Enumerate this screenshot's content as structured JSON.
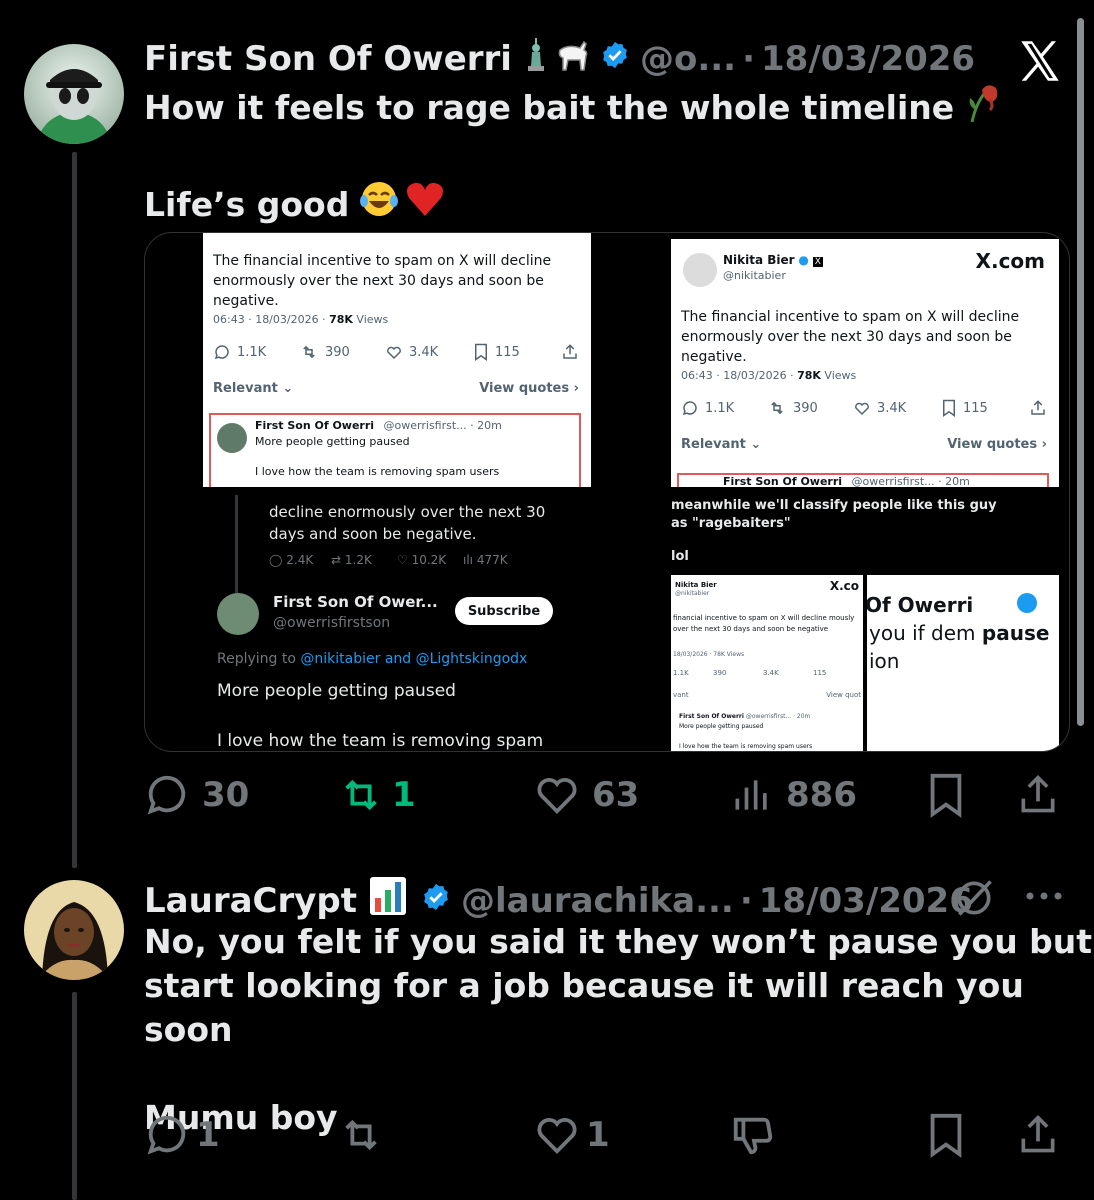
{
  "tweet1": {
    "display_name": "First Son Of Owerri",
    "handle": "@o...",
    "separator": "·",
    "date": "18/03/2026",
    "line1": "How it feels to rage bait the whole timeline",
    "line2": "Life’s good",
    "replies": "30",
    "reposts": "1",
    "likes": "63",
    "views": "886"
  },
  "media": {
    "a": {
      "text": "The financial incentive to spam on X will decline enormously over the next 30 days and soon be negative.",
      "meta_time": "06:43 · 18/03/2026 · ",
      "meta_views": "78K",
      "meta_views_label": " Views",
      "replies": "1.1K",
      "reposts": "390",
      "likes": "3.4K",
      "bookmarks": "115",
      "relevant": "Relevant",
      "view_quotes": "View quotes",
      "reply_name": "First Son Of Owerri",
      "reply_handle": "@owerrisfirst... · 20m",
      "reply_text1": "More people getting paused",
      "reply_text2": "I love how the team is removing spam users"
    },
    "b": {
      "name": "Nikita Bier",
      "handle": "@nikitabier",
      "brand": "X.com",
      "text": "The financial incentive to spam on X will decline enormously over the next 30 days and soon be negative.",
      "meta_time": "06:43 · 18/03/2026 · ",
      "meta_views": "78K",
      "meta_views_label": " Views",
      "replies": "1.1K",
      "reposts": "390",
      "likes": "3.4K",
      "bookmarks": "115",
      "relevant": "Relevant",
      "view_quotes": "View quotes",
      "reply_name": "First Son Of Owerri",
      "reply_handle": "@owerrisfirst... · 20m"
    },
    "c": {
      "text": "decline enormously over the next 30 days and soon be negative.",
      "replies": "2.4K",
      "reposts": "1.2K",
      "likes": "10.2K",
      "views": "477K",
      "name": "First Son Of Ower...",
      "handle": "@owerrisfirstson",
      "subscribe": "Subscribe",
      "replying_prefix": "Replying to ",
      "replying_targets": "@nikitabier and @Lightskingodx",
      "reply_text1": "More people getting paused",
      "reply_text2": "I love how the team is removing spam"
    },
    "d": {
      "caption1": "meanwhile we'll classify people like this guy as \"ragebaiters\"",
      "caption2": "lol",
      "mini_name": "Nikita Bier",
      "mini_handle": "@nikitabier",
      "mini_brand": "X.co",
      "mini_text": "financial incentive to spam on X will decline mously over the next 30 days and soon be negative",
      "mini_meta": "18/03/2026 · 78K Views",
      "mini_replies": "1.1K",
      "mini_reposts": "390",
      "mini_likes": "3.4K",
      "mini_bookmarks": "115",
      "mini_relevant": "vant",
      "mini_quotes": "View quot",
      "mini_reply_name": "First Son Of Owerri",
      "mini_reply_handle": "@owerrisfirst... · 20m",
      "mini_reply_text1": "More people getting paused",
      "mini_reply_text2": "I love how the team is removing spam users",
      "zoom_line1": "Of Owerri",
      "zoom_line2a": "you if dem ",
      "zoom_line2b": "pause",
      "zoom_line3": "ion"
    }
  },
  "tweet2": {
    "display_name": "LauraCrypt",
    "handle": "@laurachika...",
    "separator": "·",
    "date": "18/03/2026",
    "line1": "No, you felt if you said it they won’t pause you but",
    "line2": "start looking for a job because it will reach you soon",
    "line3": "Mumu boy",
    "replies": "1",
    "likes": "1"
  },
  "colors": {
    "background": "#000000",
    "text": "#e7e9ea",
    "muted": "#71767b",
    "verified": "#1d9bf0",
    "repost_active": "#00ba7c",
    "link": "#1d9bf0"
  }
}
